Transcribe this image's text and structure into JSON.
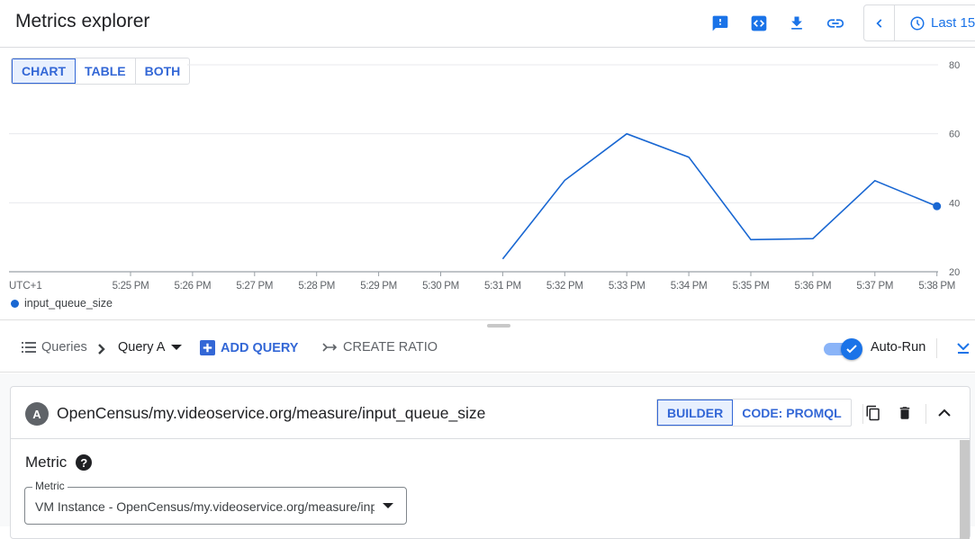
{
  "header": {
    "title": "Metrics explorer",
    "icons": [
      "feedback-icon",
      "code-icon",
      "download-icon",
      "link-icon"
    ],
    "time_range": "Last 15",
    "accent": "#1a73e8"
  },
  "view_toggle": {
    "options": [
      "CHART",
      "TABLE",
      "BOTH"
    ],
    "selected": "CHART"
  },
  "chart_data": {
    "type": "line",
    "title": "",
    "xlabel": "UTC+1",
    "ylabel": "",
    "x_ticks": [
      "5:25 PM",
      "5:26 PM",
      "5:27 PM",
      "5:28 PM",
      "5:29 PM",
      "5:30 PM",
      "5:31 PM",
      "5:32 PM",
      "5:33 PM",
      "5:34 PM",
      "5:35 PM",
      "5:36 PM",
      "5:37 PM",
      "5:38 PM"
    ],
    "y_ticks": [
      20,
      40,
      60,
      80
    ],
    "ylim": [
      20,
      80
    ],
    "grid": true,
    "legend": "bottom-left",
    "series": [
      {
        "name": "input_queue_size",
        "color": "#1967d2",
        "x": [
          "5:31 PM",
          "5:32 PM",
          "5:33 PM",
          "5:34 PM",
          "5:35 PM",
          "5:36 PM",
          "5:37 PM",
          "5:38 PM"
        ],
        "values": [
          23.7,
          46.5,
          60.0,
          53.2,
          29.3,
          29.6,
          46.4,
          39.0
        ]
      }
    ]
  },
  "query_bar": {
    "queries_label": "Queries",
    "current_query": "Query A",
    "add_query": "ADD QUERY",
    "create_ratio": "CREATE RATIO",
    "auto_run_label": "Auto-Run",
    "auto_run_on": true
  },
  "query_card": {
    "badge": "A",
    "name": "OpenCensus/my.videoservice.org/measure/input_queue_size",
    "modes": [
      "BUILDER",
      "CODE: PROMQL"
    ],
    "selected_mode": "BUILDER",
    "metric_heading": "Metric",
    "metric_field_label": "Metric",
    "metric_field_value": "VM Instance - OpenCensus/my.videoservice.org/measure/input_queue_size"
  }
}
